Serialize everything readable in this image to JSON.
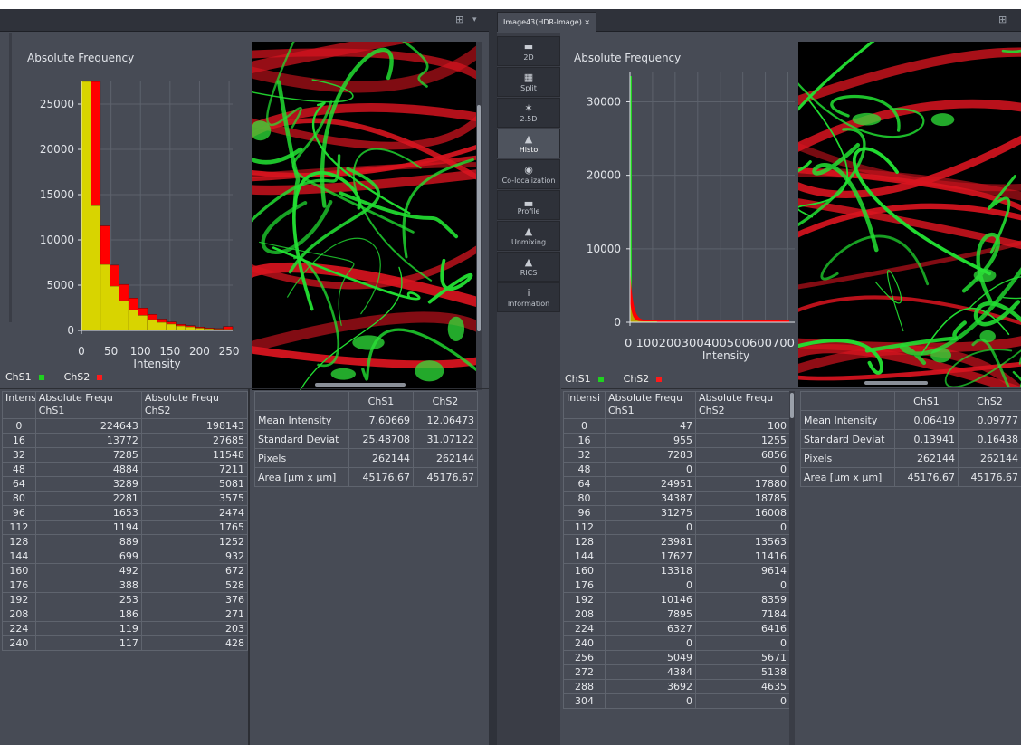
{
  "tabs": {
    "left_grid_icon": "grid-icon",
    "left_arrow": "▾",
    "right_tab_label": "Image43(HDR-Image)",
    "right_tab_close": "×",
    "right_grid_icon": "grid-icon"
  },
  "toolbar": [
    {
      "label": "2D",
      "icon": "▬",
      "active": false
    },
    {
      "label": "Split",
      "icon": "▦",
      "active": false
    },
    {
      "label": "2.5D",
      "icon": "✶",
      "active": false
    },
    {
      "label": "Histo",
      "icon": "▲",
      "active": true
    },
    {
      "label": "Co-localization",
      "icon": "◉",
      "active": false
    },
    {
      "label": "Profile",
      "icon": "▃",
      "active": false
    },
    {
      "label": "Unmixing",
      "icon": "▲",
      "active": false
    },
    {
      "label": "RICS",
      "icon": "▲",
      "active": false
    },
    {
      "label": "Information",
      "icon": "i",
      "active": false
    }
  ],
  "colors": {
    "chs1": "#1fd21f",
    "chs2": "#ff1a1a",
    "yellow": "#d8d400",
    "red_bar": "#ff0000"
  },
  "legend": {
    "chs1": "ChS1",
    "chs2": "ChS2"
  },
  "chart_data": [
    {
      "type": "bar",
      "title": "Absolute Frequency",
      "xlabel": "Intensity",
      "ylabel": "",
      "xlim": [
        0,
        256
      ],
      "ylim": [
        0,
        27500
      ],
      "yticks": [
        0,
        5000,
        10000,
        15000,
        20000,
        25000
      ],
      "xticks": [
        0,
        50,
        100,
        150,
        200,
        250
      ],
      "bin_width": 16,
      "bins": [
        0,
        16,
        32,
        48,
        64,
        80,
        96,
        112,
        128,
        144,
        160,
        176,
        192,
        208,
        224,
        240
      ],
      "series": [
        {
          "name": "ChS1",
          "color": "#d8d400",
          "values": [
            224643,
            13772,
            7285,
            4884,
            3289,
            2281,
            1653,
            1194,
            889,
            699,
            492,
            388,
            253,
            186,
            119,
            117
          ]
        },
        {
          "name": "ChS2",
          "color": "#ff0000",
          "values": [
            198143,
            27685,
            11548,
            7211,
            5081,
            3575,
            2474,
            1765,
            1252,
            932,
            672,
            528,
            376,
            271,
            203,
            428
          ]
        }
      ]
    },
    {
      "type": "bar",
      "title": "Absolute Frequency",
      "xlabel": "Intensity",
      "ylabel": "",
      "xlim": [
        0,
        730
      ],
      "ylim": [
        0,
        34000
      ],
      "yticks": [
        0,
        10000,
        20000,
        30000
      ],
      "xtick_text": "0 100200300400500600700",
      "series": [
        {
          "name": "ChS1",
          "color": "#1fd21f"
        },
        {
          "name": "ChS2",
          "color": "#ff0000"
        }
      ]
    }
  ],
  "left_table": {
    "headers": [
      "Intensi",
      "Absolute Frequ ChS1",
      "Absolute Frequ ChS2"
    ],
    "h1a": "Absolute Frequ",
    "h1b": "ChS1",
    "h2a": "Absolute Frequ",
    "h2b": "ChS2",
    "rows": [
      [
        "0",
        "224643",
        "198143"
      ],
      [
        "16",
        "13772",
        "27685"
      ],
      [
        "32",
        "7285",
        "11548"
      ],
      [
        "48",
        "4884",
        "7211"
      ],
      [
        "64",
        "3289",
        "5081"
      ],
      [
        "80",
        "2281",
        "3575"
      ],
      [
        "96",
        "1653",
        "2474"
      ],
      [
        "112",
        "1194",
        "1765"
      ],
      [
        "128",
        "889",
        "1252"
      ],
      [
        "144",
        "699",
        "932"
      ],
      [
        "160",
        "492",
        "672"
      ],
      [
        "176",
        "388",
        "528"
      ],
      [
        "192",
        "253",
        "376"
      ],
      [
        "208",
        "186",
        "271"
      ],
      [
        "224",
        "119",
        "203"
      ],
      [
        "240",
        "117",
        "428"
      ]
    ]
  },
  "left_stats": {
    "headers": [
      "",
      "ChS1",
      "ChS2"
    ],
    "rows": [
      [
        "Mean Intensity",
        "7.60669",
        "12.06473"
      ],
      [
        "Standard Deviat",
        "25.48708",
        "31.07122"
      ],
      [
        "Pixels",
        "262144",
        "262144"
      ],
      [
        "Area [µm x µm]",
        "45176.67",
        "45176.67"
      ]
    ]
  },
  "right_table": {
    "h0": "Intensi",
    "h1a": "Absolute Frequ",
    "h1b": "ChS1",
    "h2a": "Absolute Frequ",
    "h2b": "ChS2",
    "rows": [
      [
        "0",
        "47",
        "100"
      ],
      [
        "16",
        "955",
        "1255"
      ],
      [
        "32",
        "7283",
        "6856"
      ],
      [
        "48",
        "0",
        "0"
      ],
      [
        "64",
        "24951",
        "17880"
      ],
      [
        "80",
        "34387",
        "18785"
      ],
      [
        "96",
        "31275",
        "16008"
      ],
      [
        "112",
        "0",
        "0"
      ],
      [
        "128",
        "23981",
        "13563"
      ],
      [
        "144",
        "17627",
        "11416"
      ],
      [
        "160",
        "13318",
        "9614"
      ],
      [
        "176",
        "0",
        "0"
      ],
      [
        "192",
        "10146",
        "8359"
      ],
      [
        "208",
        "7895",
        "7184"
      ],
      [
        "224",
        "6327",
        "6416"
      ],
      [
        "240",
        "0",
        "0"
      ],
      [
        "256",
        "5049",
        "5671"
      ],
      [
        "272",
        "4384",
        "5138"
      ],
      [
        "288",
        "3692",
        "4635"
      ],
      [
        "304",
        "0",
        "0"
      ]
    ]
  },
  "right_stats": {
    "headers": [
      "",
      "ChS1",
      "ChS2"
    ],
    "rows": [
      [
        "Mean Intensity",
        "0.06419",
        "0.09777"
      ],
      [
        "Standard Deviat",
        "0.13941",
        "0.16438"
      ],
      [
        "Pixels",
        "262144",
        "262144"
      ],
      [
        "Area [µm x µm]",
        "45176.67",
        "45176.67"
      ]
    ]
  }
}
